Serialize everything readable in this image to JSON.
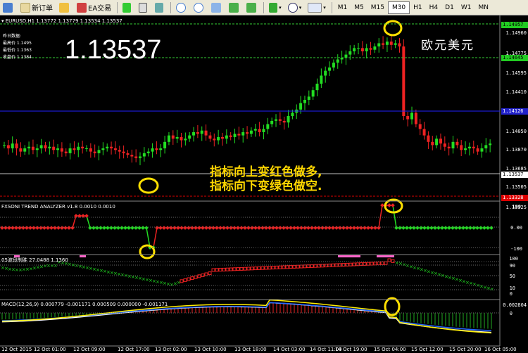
{
  "toolbar": {
    "new_order": "新订单",
    "ea_trade": "EA交易",
    "timeframes": [
      "M1",
      "M5",
      "M15",
      "M30",
      "H1",
      "H4",
      "D1",
      "W1",
      "MN"
    ],
    "active_tf": "M30"
  },
  "chart": {
    "symbol_line": "EURUSD,H1  1.13772 1.13779 1.13534 1.13537",
    "info_lines": [
      "昨日数据:",
      "最高价 1.1495",
      "最低价 1.1363",
      "收盘价 1.1384"
    ],
    "big_price": "1.13537",
    "title_cn": "欧元美元",
    "note_line1": "指标向上变红色做多,",
    "note_line2": "指标向下变绿色做空.",
    "price_axis": [
      "1.14960",
      "1.14775",
      "1.14595",
      "1.14410",
      "1.14230",
      "1.14050",
      "1.13870",
      "1.13685",
      "1.13505",
      "1.13325"
    ],
    "tags": {
      "top": "1.14957",
      "mid_green": "1.14645",
      "blue": "1.14126",
      "current": "1.13537",
      "red": "1.13328"
    }
  },
  "indicator1": {
    "title": "FXSONI TREND ANALYZER v1.8 0.0010 0.0010",
    "axis": [
      "100",
      "0.00",
      "-100"
    ]
  },
  "indicator2": {
    "title": "05波段制胜 27.0488 1.1360",
    "axis": [
      "100",
      "90",
      "50",
      "10",
      "0"
    ]
  },
  "indicator3": {
    "title": "MACD(12,26,9) 0.000779 -0.001171 0.000509 0.000000 -0.001171",
    "axis": [
      "0.002804",
      "0"
    ]
  },
  "time_axis": [
    "12 Oct 2015",
    "12 Oct 01:00",
    "12 Oct 09:00",
    "12 Oct 17:00",
    "13 Oct 02:00",
    "13 Oct 10:00",
    "13 Oct 18:00",
    "14 Oct 03:00",
    "14 Oct 11:00",
    "14 Oct 19:00",
    "15 Oct 04:00",
    "15 Oct 12:00",
    "15 Oct 20:00",
    "16 Oct 05:00"
  ]
}
